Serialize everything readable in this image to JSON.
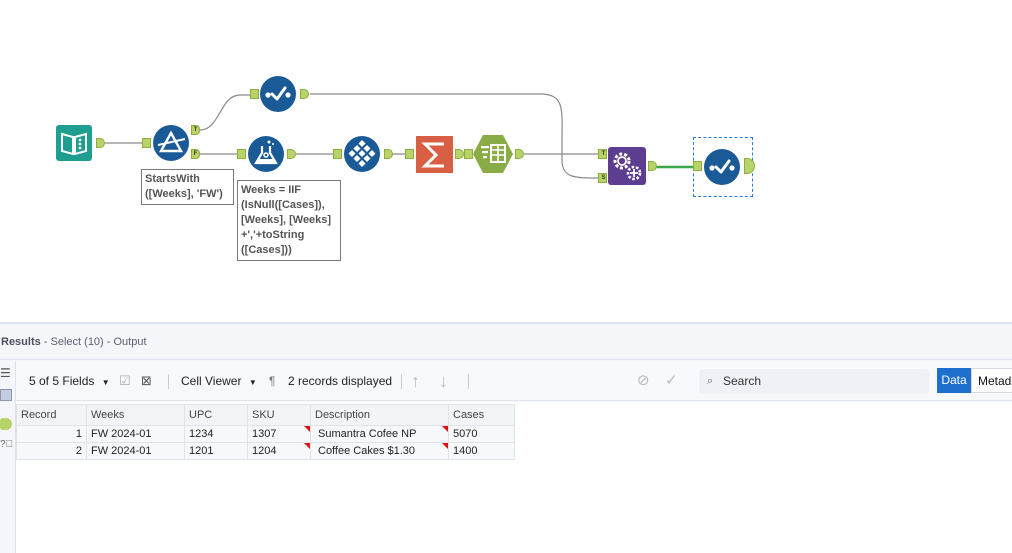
{
  "workflow": {
    "tools": [
      {
        "id": "input",
        "icon": "input-data-book-icon",
        "color": "#1e9e8e"
      },
      {
        "id": "filter",
        "icon": "filter-prism-icon",
        "color": "#1a5a97",
        "anchors": [
          "T",
          "F"
        ]
      },
      {
        "id": "select-top",
        "icon": "select-check-icon",
        "color": "#1a5a97"
      },
      {
        "id": "formula",
        "icon": "formula-flask-icon",
        "color": "#1a5a97"
      },
      {
        "id": "multi-row",
        "icon": "multi-row-diamond-icon",
        "color": "#1a5a97"
      },
      {
        "id": "summarize",
        "icon": "summarize-sigma-icon",
        "color": "#d95f44"
      },
      {
        "id": "crosstab",
        "icon": "crosstab-table-icon",
        "color": "#8aac46"
      },
      {
        "id": "macro",
        "icon": "macro-gears-icon",
        "color": "#5c3d8f",
        "anchors": [
          "T",
          "S"
        ]
      },
      {
        "id": "select-output",
        "icon": "select-check-icon",
        "color": "#1a5a97",
        "selected": true
      }
    ],
    "annotations": {
      "filter": "StartsWith\n([Weeks], 'FW')",
      "formula": "Weeks = IIF\n(IsNull([Cases]),\n[Weeks], [Weeks]\n+','+toString\n([Cases]))"
    },
    "anchor_labels": {
      "filter_true": "T",
      "filter_false": "F",
      "macro_top": "T",
      "macro_bottom": "S"
    }
  },
  "results": {
    "title": "Results",
    "subtitle": " - Select (10) - Output",
    "toolbar": {
      "fields_label": "5 of 5 Fields",
      "cell_viewer_label": "Cell Viewer",
      "records_label": "2 records displayed",
      "search_placeholder": "Search",
      "data_tab": "Data",
      "metadata_tab": "Metad"
    },
    "table": {
      "columns": [
        "Record",
        "Weeks",
        "UPC",
        "SKU",
        "Description",
        "Cases"
      ],
      "rows": [
        [
          "1",
          "FW 2024-01",
          "1234",
          "1307",
          "Sumantra Cofee NP",
          "5070"
        ],
        [
          "2",
          "FW 2024-01",
          "1201",
          "1204",
          "Coffee Cakes $1.30",
          "1400"
        ]
      ]
    }
  }
}
